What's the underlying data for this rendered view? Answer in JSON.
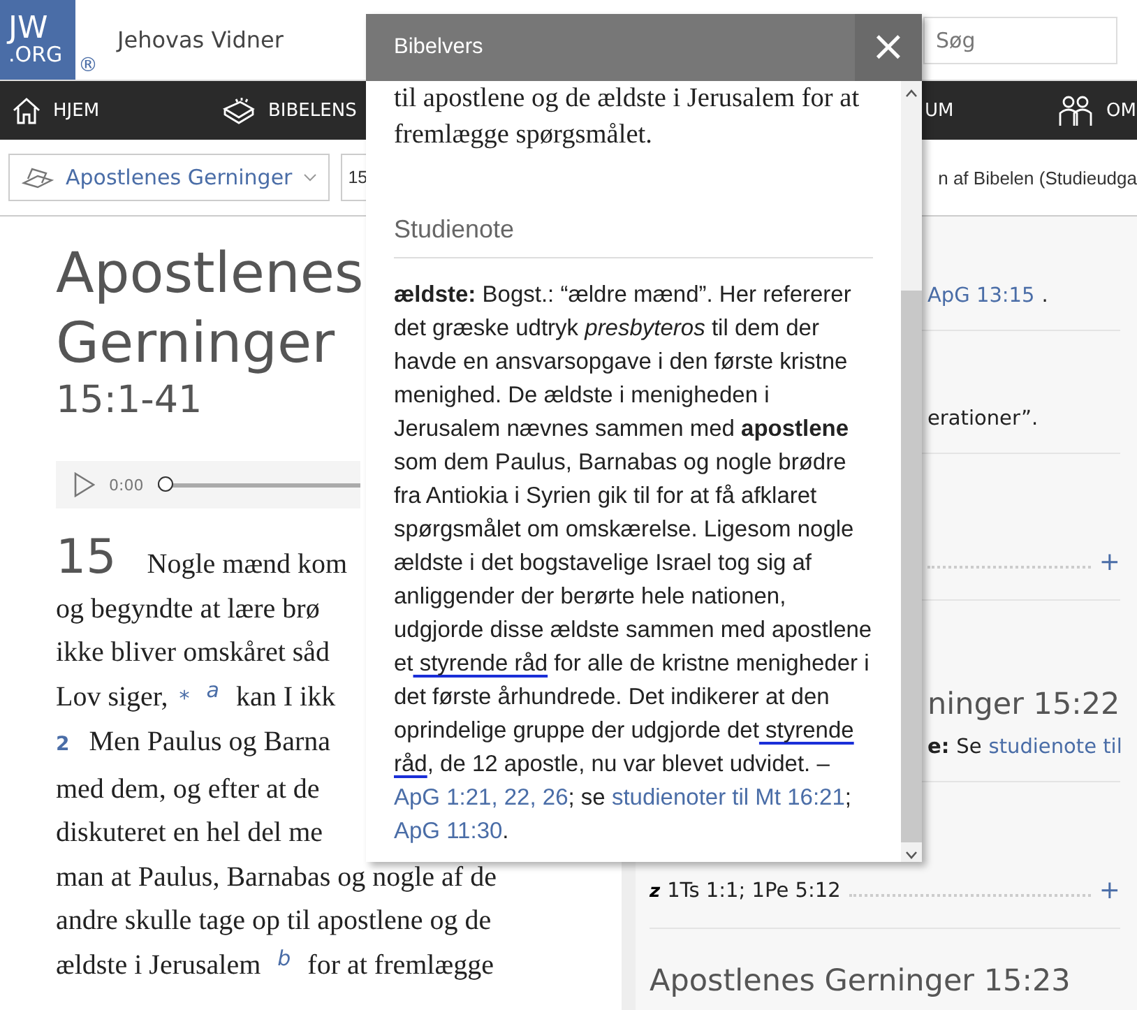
{
  "header": {
    "logo_top": "JW",
    "logo_bottom": ".ORG",
    "registered": "®",
    "site_name": "Jehovas Vidner",
    "search": {
      "placeholder": "Søg"
    }
  },
  "nav": [
    {
      "kind": "house",
      "label": "HJEM"
    },
    {
      "kind": "bible",
      "label": "BIBELENS"
    },
    {
      "kind": "plain",
      "label": "UM"
    },
    {
      "kind": "people",
      "label": "OM"
    }
  ],
  "toolbar": {
    "book_select": "Apostlenes Gerninger",
    "chapter_select": "15",
    "translation": "n af Bibelen (Studieudga"
  },
  "article": {
    "title": "Apostlenes Gerninger",
    "reference": "15:1-41",
    "audio": {
      "time": "0:00",
      "level": 0
    },
    "chapter_number": "15",
    "lines": [
      [
        {
          "kind": "text",
          "text": "Nogle mænd kom"
        }
      ],
      [
        {
          "kind": "text",
          "text": "og begyndte at lære brø"
        }
      ],
      [
        {
          "kind": "text",
          "text": "ikke bliver omskåret såd"
        }
      ],
      [
        {
          "kind": "text",
          "text": "Lov siger,"
        },
        {
          "kind": "mark",
          "text": "*"
        },
        {
          "kind": "footnote",
          "text": "a"
        },
        {
          "kind": "text",
          "text": "kan I ikk"
        }
      ],
      [
        {
          "kind": "verse",
          "text": "2"
        },
        {
          "kind": "text",
          "text": "Men Paulus og Barna"
        }
      ],
      [
        {
          "kind": "text",
          "text": "med dem, og efter at de"
        }
      ],
      [
        {
          "kind": "text",
          "text": "diskuteret en hel del me"
        }
      ],
      [
        {
          "kind": "text",
          "text": "man at Paulus, Barnabas og nogle af de"
        }
      ],
      [
        {
          "kind": "text",
          "text": "andre skulle tage op til apostlene og de"
        }
      ],
      [
        {
          "kind": "text",
          "text": "ældste i Jerusalem"
        },
        {
          "kind": "footnote",
          "text": "b"
        },
        {
          "kind": "text",
          "text": "for at fremlægge"
        }
      ]
    ]
  },
  "side": [
    {
      "kind": "note",
      "parts": [
        {
          "kind": "link",
          "text": "ApG 13:15"
        },
        {
          "kind": "text",
          "text": "."
        }
      ]
    },
    {
      "kind": "note",
      "parts": [
        {
          "kind": "text",
          "text": "erationer”."
        }
      ]
    },
    {
      "kind": "expander",
      "toggle": "+"
    },
    {
      "kind": "heading",
      "text": "ninger 15:22",
      "parts": [
        {
          "kind": "bold",
          "text": "e:"
        },
        {
          "kind": "text",
          "text": "Se"
        },
        {
          "kind": "link",
          "text": "studienote til"
        }
      ]
    },
    {
      "kind": "expander",
      "toggle": "+",
      "parts": [
        {
          "kind": "letter",
          "text": "z"
        },
        {
          "kind": "text",
          "text": "1Ts 1:1; 1Pe 5:12"
        }
      ]
    },
    {
      "kind": "heading",
      "text": "Apostlenes Gerninger 15:23"
    }
  ],
  "popup": {
    "title": "Bibelvers",
    "close": "×",
    "verse_text": "til apostlene og de ældste i Jerusalem for at fremlægge spørgsmålet.",
    "section_title": "Studienote",
    "note": [
      {
        "kind": "text",
        "text": "**ældste:** Bogst.: “ældre mænd”. Her refererer det græske udtryk *presbyteros* til dem der havde en ansvarsopgave i den første kristne menighed. De ældste i menigheden i Jerusalem nævnes sammen med **apostlene** som dem Paulus, Barnabas og nogle brødre fra Antiokia i Syrien gik til for at få afklaret spørgsmålet om omskærelse. Ligesom nogle ældste i det bogstavelige Israel tog sig af anliggender der berørte hele nationen, udgjorde disse ældste sammen med apostlene et"
      },
      {
        "kind": "ink",
        "text": " styrende råd"
      },
      {
        "kind": "text",
        "text": " for alle de kristne menigheder i det første århundrede. Det indikerer at den oprindelige gruppe der udgjorde det"
      },
      {
        "kind": "ink",
        "text": " styrende råd"
      },
      {
        "kind": "text",
        "text": ", de 12 apostle, nu var blevet udvidet. – "
      },
      {
        "kind": "link",
        "text": "ApG 1:21, 22, 26"
      },
      {
        "kind": "text",
        "text": "; se "
      },
      {
        "kind": "link",
        "text": "studienoter til Mt 16:21"
      },
      {
        "kind": "text",
        "text": "; "
      },
      {
        "kind": "link",
        "text": "ApG 11:30"
      },
      {
        "kind": "text",
        "text": "."
      }
    ]
  }
}
